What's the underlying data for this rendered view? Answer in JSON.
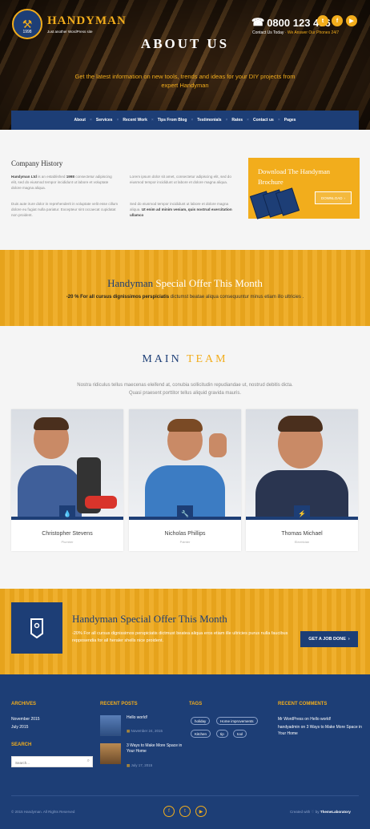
{
  "header": {
    "brand": "HANDYMAN",
    "tagline": "Just another WordPress site",
    "badge_year": "1998",
    "phone": "0800 123 456",
    "contact_prefix": "Contact Us Today",
    "contact_highlight": "· We Answer Our Phones 24/7",
    "page_title": "ABOUT US",
    "subtitle": "Get the latest information on new tools, trends and ideas for your DIY projects from expert Handyman"
  },
  "nav": {
    "items": [
      "About",
      "Services",
      "Recent Work",
      "Tips From Blog",
      "Testimonials",
      "Rates",
      "Contact us",
      "Pages"
    ]
  },
  "history": {
    "title": "Company History",
    "col1_p1_a": "Handyman Ltd",
    "col1_p1_b": " is an established ",
    "col1_p1_year": "1998",
    "col1_p1_c": " consectetur adipiscing elit, sed do eiusmod tempor incididunt ut labore et voluptate dolore magna aliqua.",
    "col1_p2": "Duis aute irure dolor in reprehenderit in voluptate velit esse cillum dolore eu fugiat nulla pariatur. Excepteur sint occaecat cupidatat non proident.",
    "col2_p1": "Lorem ipsum dolor sit amet, consectetur adipiscing elit, sed do eiusmod tempor incididunt ut labore et dolore magna aliqua.",
    "col2_p2_a": "Sed do eiusmod tempor incididunt ut labore et dolore magna aliqua. ",
    "col2_p2_b": "Ut enim ad minim veniam, quis nostrud exercitation ullamco"
  },
  "brochure": {
    "title": "Download The Handyman Brochure",
    "button": "DOWNLOAD"
  },
  "offer1": {
    "title_a": "Handyman",
    "title_b": "Special Offer This Month",
    "text_bold": "-20 % For all cursus dignissimos perspiciatis",
    "text_rest": " dictumst beatae aliqua consequuntur minus etiam illo ultricies ."
  },
  "team": {
    "title_a": "MAIN",
    "title_b": "TEAM",
    "small": "",
    "description": "Nostra ridiculus tellus maecenas eleifend at, conubia sollicitudin repudiandae ut, nostrud debitis dicta. Quasi praesent porttitor tellus aliquid gravida mauris.",
    "members": [
      {
        "name": "Christopher Stevens",
        "role": "Plumber"
      },
      {
        "name": "Nicholas Phillips",
        "role": "Painter"
      },
      {
        "name": "Thomas Michael",
        "role": "Electrician"
      }
    ]
  },
  "offer2": {
    "title": "Handyman Special Offer This Month",
    "text": "-20% For all cursus dignissimos perspiciatis dictmust beatea aliqua eros etiam ille ultricies purus nulla faucibus repposendia for all heraler shells nice proident.",
    "button": "GET A JOB DONE"
  },
  "footer": {
    "archives_title": "ARCHIVES",
    "archives": [
      "November 2015",
      "July 2015"
    ],
    "search_title": "SEARCH",
    "search_placeholder": "Search...",
    "recent_posts_title": "RECENT POSTS",
    "posts": [
      {
        "title": "Hello world!",
        "date": "November 24, 2015"
      },
      {
        "title": "3 Ways to Make More Space in Your Home",
        "date": "July 17, 2015"
      }
    ],
    "tags_title": "TAGS",
    "tags": [
      "holiday",
      "Home improvements",
      "Kitchen",
      "tip",
      "tool"
    ],
    "comments_title": "RECENT COMMENTS",
    "comment1_author": "Mr WordPress",
    "comment1_on": " on ",
    "comment1_post": "Hello world!",
    "comment2_author": "handyadmin",
    "comment2_on": " on ",
    "comment2_post": "3 Ways to Make More Space in Your Home",
    "copyright": "© 2015 Handyman. All Rights Reserved",
    "created_prefix": "Created with ♡ by",
    "created_by": "ThemeLaboratory"
  }
}
